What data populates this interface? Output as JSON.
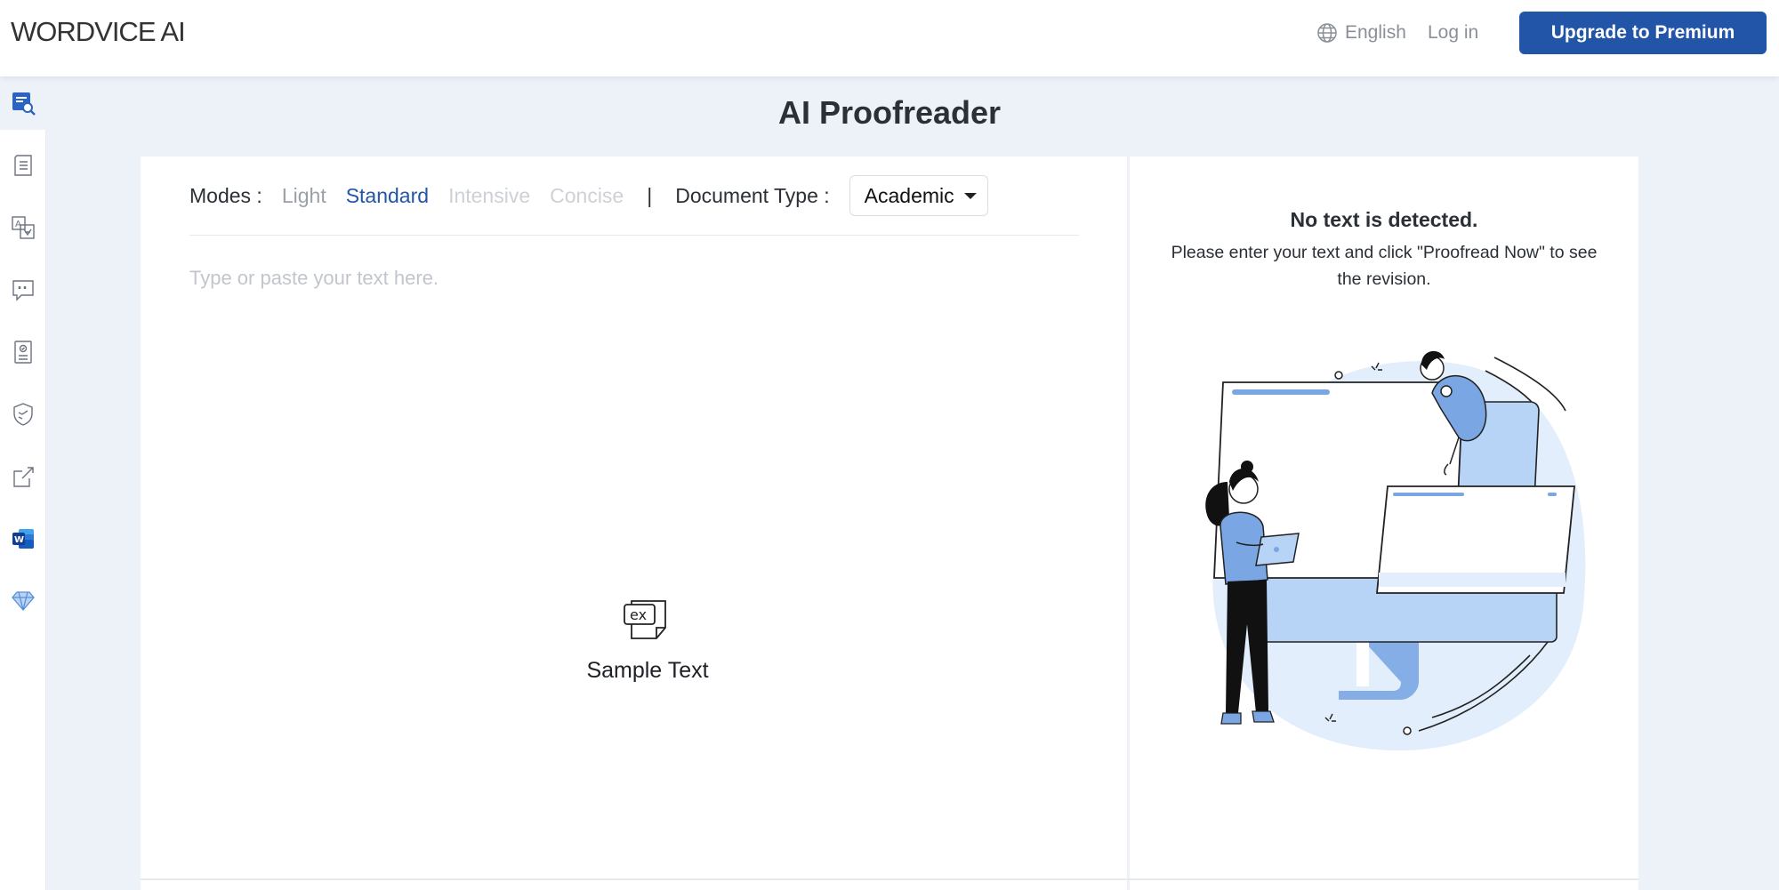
{
  "header": {
    "logo": "WORDVICE AI",
    "language": "English",
    "login": "Log in",
    "upgrade": "Upgrade to Premium"
  },
  "sidebar": {
    "items": [
      {
        "icon": "proofreader-icon",
        "active": true
      },
      {
        "icon": "document-icon"
      },
      {
        "icon": "translate-icon"
      },
      {
        "icon": "quote-chat-icon"
      },
      {
        "icon": "checklist-doc-icon"
      },
      {
        "icon": "shield-icon"
      },
      {
        "icon": "external-link-icon"
      },
      {
        "icon": "word-addin-icon"
      },
      {
        "icon": "diamond-icon"
      }
    ]
  },
  "main": {
    "title": "AI Proofreader",
    "modes_label": "Modes :",
    "modes": [
      {
        "label": "Light",
        "state": "inactive"
      },
      {
        "label": "Standard",
        "state": "active"
      },
      {
        "label": "Intensive",
        "state": "disabled"
      },
      {
        "label": "Concise",
        "state": "disabled"
      }
    ],
    "separator": "|",
    "doc_type_label": "Document Type :",
    "doc_type_value": "Academic",
    "placeholder": "Type or paste your text here.",
    "sample_icon_text": "ex",
    "sample_label": "Sample Text"
  },
  "result": {
    "heading": "No text is detected.",
    "message": "Please enter your text and click \"Proofread Now\" to see the revision."
  },
  "colors": {
    "brand": "#2255a8",
    "background": "#edf2f9",
    "illustration_blue": "#b7d3f5",
    "illustration_accent": "#7aa6e3"
  }
}
